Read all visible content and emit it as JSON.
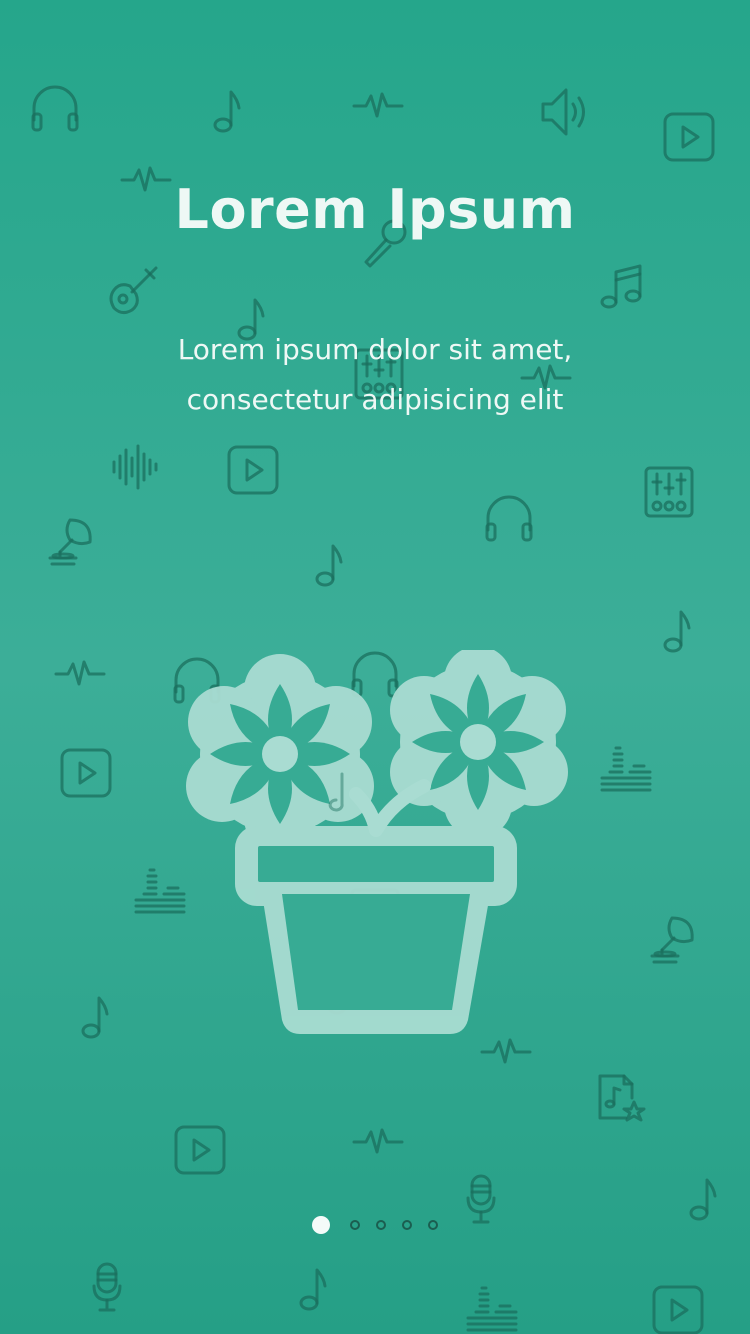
{
  "onboarding": {
    "title": "Lorem Ipsum",
    "description": "Lorem ipsum dolor sit amet, consectetur adipisicing elit",
    "illustration_icon": "flower-pot-icon",
    "current_page": 1,
    "total_pages": 5
  },
  "colors": {
    "background_top": "#25a68b",
    "background_middle": "#3cae98",
    "icon_pattern": "#1b6f5d",
    "illustration": "#a9dcd2",
    "text": "#eef8f5",
    "active_dot": "#f4fbf9",
    "inactive_dot_border": "#1b5e50"
  },
  "background_pattern_icons": [
    "headphones-icon",
    "music-note-icon",
    "waveform-icon",
    "speaker-icon",
    "play-button-icon",
    "guitar-icon",
    "microphone-icon",
    "mixer-icon",
    "gramophone-icon",
    "equalizer-icon",
    "music-file-icon"
  ]
}
